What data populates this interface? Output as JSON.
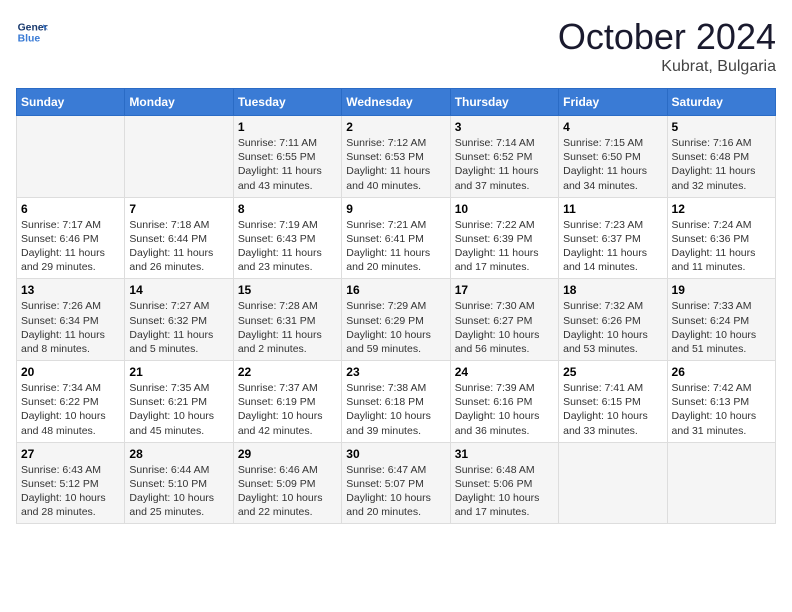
{
  "header": {
    "logo_line1": "General",
    "logo_line2": "Blue",
    "month": "October 2024",
    "location": "Kubrat, Bulgaria"
  },
  "days_of_week": [
    "Sunday",
    "Monday",
    "Tuesday",
    "Wednesday",
    "Thursday",
    "Friday",
    "Saturday"
  ],
  "weeks": [
    [
      {
        "day": "",
        "info": ""
      },
      {
        "day": "",
        "info": ""
      },
      {
        "day": "1",
        "info": "Sunrise: 7:11 AM\nSunset: 6:55 PM\nDaylight: 11 hours and 43 minutes."
      },
      {
        "day": "2",
        "info": "Sunrise: 7:12 AM\nSunset: 6:53 PM\nDaylight: 11 hours and 40 minutes."
      },
      {
        "day": "3",
        "info": "Sunrise: 7:14 AM\nSunset: 6:52 PM\nDaylight: 11 hours and 37 minutes."
      },
      {
        "day": "4",
        "info": "Sunrise: 7:15 AM\nSunset: 6:50 PM\nDaylight: 11 hours and 34 minutes."
      },
      {
        "day": "5",
        "info": "Sunrise: 7:16 AM\nSunset: 6:48 PM\nDaylight: 11 hours and 32 minutes."
      }
    ],
    [
      {
        "day": "6",
        "info": "Sunrise: 7:17 AM\nSunset: 6:46 PM\nDaylight: 11 hours and 29 minutes."
      },
      {
        "day": "7",
        "info": "Sunrise: 7:18 AM\nSunset: 6:44 PM\nDaylight: 11 hours and 26 minutes."
      },
      {
        "day": "8",
        "info": "Sunrise: 7:19 AM\nSunset: 6:43 PM\nDaylight: 11 hours and 23 minutes."
      },
      {
        "day": "9",
        "info": "Sunrise: 7:21 AM\nSunset: 6:41 PM\nDaylight: 11 hours and 20 minutes."
      },
      {
        "day": "10",
        "info": "Sunrise: 7:22 AM\nSunset: 6:39 PM\nDaylight: 11 hours and 17 minutes."
      },
      {
        "day": "11",
        "info": "Sunrise: 7:23 AM\nSunset: 6:37 PM\nDaylight: 11 hours and 14 minutes."
      },
      {
        "day": "12",
        "info": "Sunrise: 7:24 AM\nSunset: 6:36 PM\nDaylight: 11 hours and 11 minutes."
      }
    ],
    [
      {
        "day": "13",
        "info": "Sunrise: 7:26 AM\nSunset: 6:34 PM\nDaylight: 11 hours and 8 minutes."
      },
      {
        "day": "14",
        "info": "Sunrise: 7:27 AM\nSunset: 6:32 PM\nDaylight: 11 hours and 5 minutes."
      },
      {
        "day": "15",
        "info": "Sunrise: 7:28 AM\nSunset: 6:31 PM\nDaylight: 11 hours and 2 minutes."
      },
      {
        "day": "16",
        "info": "Sunrise: 7:29 AM\nSunset: 6:29 PM\nDaylight: 10 hours and 59 minutes."
      },
      {
        "day": "17",
        "info": "Sunrise: 7:30 AM\nSunset: 6:27 PM\nDaylight: 10 hours and 56 minutes."
      },
      {
        "day": "18",
        "info": "Sunrise: 7:32 AM\nSunset: 6:26 PM\nDaylight: 10 hours and 53 minutes."
      },
      {
        "day": "19",
        "info": "Sunrise: 7:33 AM\nSunset: 6:24 PM\nDaylight: 10 hours and 51 minutes."
      }
    ],
    [
      {
        "day": "20",
        "info": "Sunrise: 7:34 AM\nSunset: 6:22 PM\nDaylight: 10 hours and 48 minutes."
      },
      {
        "day": "21",
        "info": "Sunrise: 7:35 AM\nSunset: 6:21 PM\nDaylight: 10 hours and 45 minutes."
      },
      {
        "day": "22",
        "info": "Sunrise: 7:37 AM\nSunset: 6:19 PM\nDaylight: 10 hours and 42 minutes."
      },
      {
        "day": "23",
        "info": "Sunrise: 7:38 AM\nSunset: 6:18 PM\nDaylight: 10 hours and 39 minutes."
      },
      {
        "day": "24",
        "info": "Sunrise: 7:39 AM\nSunset: 6:16 PM\nDaylight: 10 hours and 36 minutes."
      },
      {
        "day": "25",
        "info": "Sunrise: 7:41 AM\nSunset: 6:15 PM\nDaylight: 10 hours and 33 minutes."
      },
      {
        "day": "26",
        "info": "Sunrise: 7:42 AM\nSunset: 6:13 PM\nDaylight: 10 hours and 31 minutes."
      }
    ],
    [
      {
        "day": "27",
        "info": "Sunrise: 6:43 AM\nSunset: 5:12 PM\nDaylight: 10 hours and 28 minutes."
      },
      {
        "day": "28",
        "info": "Sunrise: 6:44 AM\nSunset: 5:10 PM\nDaylight: 10 hours and 25 minutes."
      },
      {
        "day": "29",
        "info": "Sunrise: 6:46 AM\nSunset: 5:09 PM\nDaylight: 10 hours and 22 minutes."
      },
      {
        "day": "30",
        "info": "Sunrise: 6:47 AM\nSunset: 5:07 PM\nDaylight: 10 hours and 20 minutes."
      },
      {
        "day": "31",
        "info": "Sunrise: 6:48 AM\nSunset: 5:06 PM\nDaylight: 10 hours and 17 minutes."
      },
      {
        "day": "",
        "info": ""
      },
      {
        "day": "",
        "info": ""
      }
    ]
  ]
}
